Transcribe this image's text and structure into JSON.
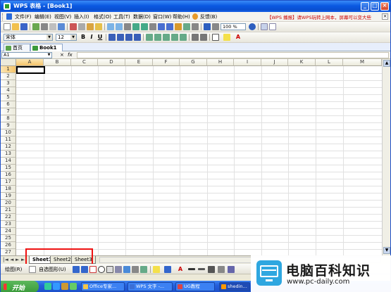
{
  "window": {
    "title": "WPS 表格 - [Book1]",
    "minimize": "_",
    "maximize": "□",
    "close": "×"
  },
  "menu": {
    "items": [
      "文件(F)",
      "编辑(E)",
      "视图(V)",
      "插入(I)",
      "格式(O)",
      "工具(T)",
      "数据(D)",
      "窗口(W)",
      "帮助(H)",
      "反馈(B)"
    ],
    "ad": "【WPS 播报】请WPS玩转上网本，屏幕可以变大些",
    "close": "×"
  },
  "toolbar": {
    "font_name": "宋体",
    "font_size": "12",
    "bold": "B",
    "italic": "I",
    "underline": "U",
    "zoom": "100 %",
    "font_color_letter": "A"
  },
  "doc_tabs": [
    {
      "label": "首页",
      "active": false
    },
    {
      "label": "Book1",
      "active": true
    }
  ],
  "formula_bar": {
    "name_box": "A1",
    "cancel": "×",
    "fx": "fx",
    "value": ""
  },
  "grid": {
    "columns": [
      "A",
      "B",
      "C",
      "D",
      "E",
      "F",
      "G",
      "H",
      "I",
      "J",
      "K",
      "L",
      "M"
    ],
    "rows": [
      "1",
      "2",
      "3",
      "4",
      "5",
      "6",
      "7",
      "8",
      "9",
      "10",
      "11",
      "12",
      "13",
      "14",
      "15",
      "16",
      "17",
      "18",
      "19",
      "20",
      "21",
      "22",
      "23",
      "24",
      "25",
      "26",
      "27"
    ],
    "active_cell": "A1"
  },
  "sheets": {
    "tabs": [
      "Sheet1",
      "Sheet2",
      "Sheet3"
    ],
    "active": "Sheet1",
    "nav": [
      "|◄",
      "◄",
      "►",
      "►|"
    ]
  },
  "draw_toolbar": {
    "draw_label": "绘图(R)",
    "autoshape_label": "自选图形(U)"
  },
  "taskbar": {
    "start": "开始",
    "tasks": [
      "Office专家...",
      "WPS 文字 -...",
      "UG教程",
      "shedin..."
    ]
  },
  "watermark": {
    "title": "电脑百科知识",
    "url": "www.pc-daily.com"
  },
  "colors": {
    "title_bar": "#0a59e2",
    "active_header": "#f6c56a",
    "red_highlight": "#e11111",
    "watermark_blue": "#2ea7e0"
  }
}
